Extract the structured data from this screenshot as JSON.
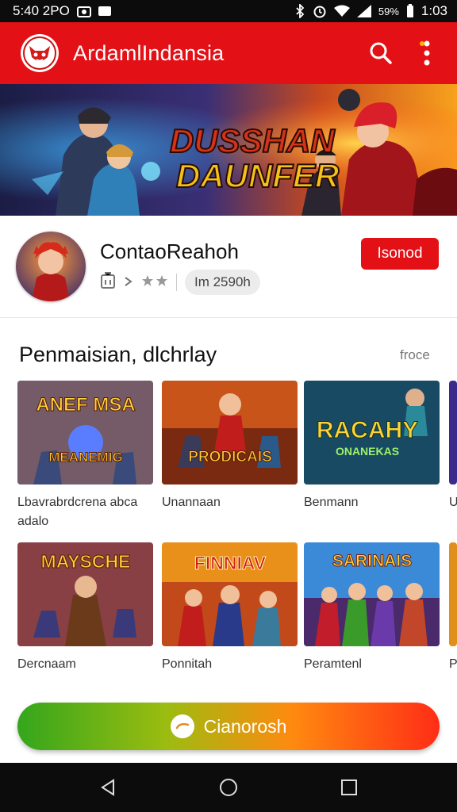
{
  "status_bar": {
    "left_text": "5:40 2ΡO",
    "time": "1:03",
    "battery_text": "59%"
  },
  "app_bar": {
    "title": "ArdamlIndansia",
    "icons": [
      "logo-icon",
      "search-icon",
      "more-icon"
    ]
  },
  "banner": {
    "title_line1": "DUSSHAN",
    "title_line2": "DAUNFER"
  },
  "profile": {
    "name": "ContaoReahoh",
    "meta_chip": "Im 2590h",
    "follow_label": "Isonod"
  },
  "section": {
    "title": "Penmaisian, dlchrlay",
    "more_label": "froce"
  },
  "cards": [
    {
      "label": "Lbavrabrdcrena abca adalo",
      "thumb_title": "ANEF MSA",
      "thumb_sub": "MEANEMIG"
    },
    {
      "label": "Unannaan",
      "thumb_title": "PRODICAIS",
      "thumb_sub": ""
    },
    {
      "label": "Benmann",
      "thumb_title": "RACAHY",
      "thumb_sub": "ONANEKAS"
    },
    {
      "label": "U",
      "thumb_title": "",
      "thumb_sub": ""
    },
    {
      "label": "Dercnaam",
      "thumb_title": "MAYSCHE",
      "thumb_sub": ""
    },
    {
      "label": "Ponnitah",
      "thumb_title": "FINNIAV",
      "thumb_sub": ""
    },
    {
      "label": "Peramtenl",
      "thumb_title": "SARINAIS",
      "thumb_sub": ""
    },
    {
      "label": "P",
      "thumb_title": "",
      "thumb_sub": ""
    }
  ],
  "cta": {
    "label": "Cianorosh"
  },
  "colors": {
    "brand_red": "#e31016",
    "status_bg": "#0c0c0c"
  }
}
